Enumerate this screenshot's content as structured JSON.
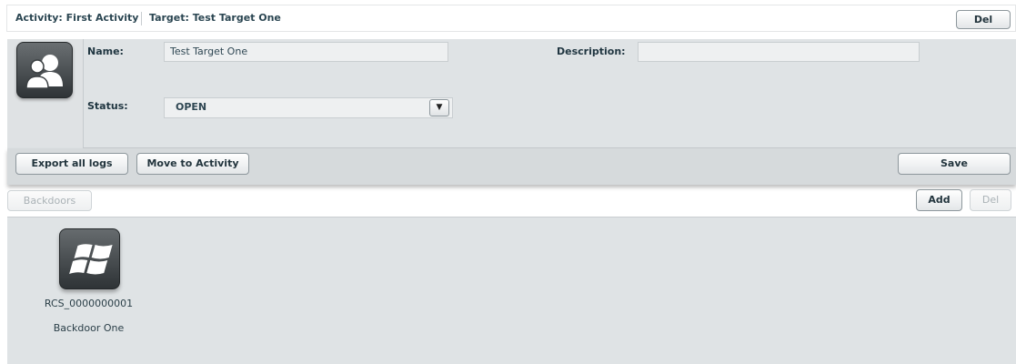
{
  "breadcrumb": {
    "activity": "Activity: First Activity",
    "target": "Target: Test Target One"
  },
  "toolbar": {
    "delete_label": "Del"
  },
  "target_form": {
    "name_label": "Name:",
    "name_value": "Test Target One",
    "description_label": "Description:",
    "description_value": "",
    "status_label": "Status:",
    "status_value": "OPEN",
    "avatar_icon": "target-avatar-icon"
  },
  "actions": {
    "export_label": "Export all logs",
    "move_label": "Move to Activity",
    "save_label": "Save"
  },
  "backdoors_bar": {
    "tab_label": "Backdoors",
    "add_label": "Add",
    "del_label": "Del"
  },
  "backdoors": [
    {
      "id": "RCS_0000000001",
      "name": "Backdoor One",
      "icon": "windows-icon"
    }
  ]
}
